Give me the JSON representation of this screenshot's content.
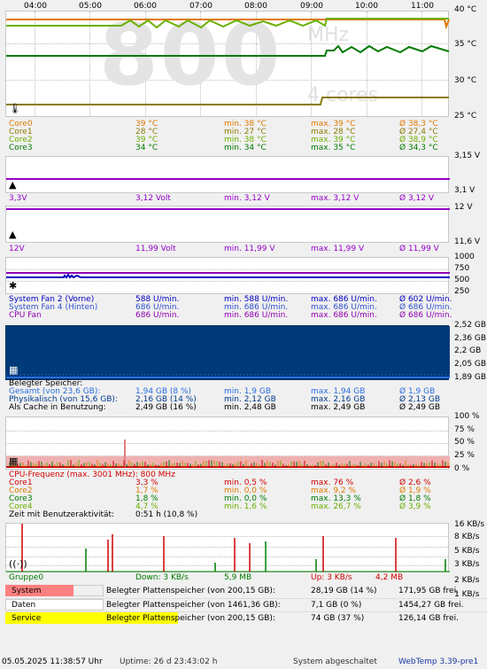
{
  "time_axis": [
    "04:00",
    "05:00",
    "06:00",
    "07:00",
    "08:00",
    "09:00",
    "10:00",
    "11:00"
  ],
  "temp": {
    "y_labels": [
      "40 °C",
      "35 °C",
      "30 °C",
      "25 °C"
    ],
    "watermark_value": "800",
    "watermark_unit": "MHz",
    "watermark_cores": "4 cores",
    "rows": [
      {
        "name": "Core0",
        "cur": "39 °C",
        "min": "min. 38 °C",
        "max": "max. 39 °C",
        "avg": "Ø 38,3 °C",
        "color": "#e07800"
      },
      {
        "name": "Core1",
        "cur": "28 °C",
        "min": "min. 27 °C",
        "max": "max. 28 °C",
        "avg": "Ø 27,4 °C",
        "color": "#8b7a00"
      },
      {
        "name": "Core2",
        "cur": "39 °C",
        "min": "min. 38 °C",
        "max": "max. 39 °C",
        "avg": "Ø 38,9 °C",
        "color": "#6ab000"
      },
      {
        "name": "Core3",
        "cur": "34 °C",
        "min": "min. 34 °C",
        "max": "max. 35 °C",
        "avg": "Ø 34,3 °C",
        "color": "#007a00"
      }
    ]
  },
  "v33": {
    "y_labels": [
      "3,15 V",
      "3,1 V"
    ],
    "row": {
      "name": "3,3V",
      "cur": "3,12 Volt",
      "min": "min. 3,12 V",
      "max": "max. 3,12 V",
      "avg": "Ø 3,12 V",
      "color": "#9400c8"
    }
  },
  "v12": {
    "y_labels": [
      "12 V",
      "11,6 V"
    ],
    "row": {
      "name": "12V",
      "cur": "11,99 Volt",
      "min": "min. 11,99 V",
      "max": "max. 11,99 V",
      "avg": "Ø 11,99 V",
      "color": "#9400c8"
    }
  },
  "fans": {
    "y_labels": [
      "1000",
      "750",
      "500",
      "250"
    ],
    "rows": [
      {
        "name": "System Fan 2 (Vorne)",
        "cur": "588 U/min.",
        "min": "min. 588 U/min.",
        "max": "max. 686 U/min.",
        "avg": "Ø 602 U/min.",
        "color": "#0000c0"
      },
      {
        "name": "System Fan 4 (Hinten)",
        "cur": "686 U/min.",
        "min": "min. 686 U/min.",
        "max": "max. 686 U/min.",
        "avg": "Ø 686 U/min.",
        "color": "#3050d0"
      },
      {
        "name": "CPU Fan",
        "cur": "686 U/min.",
        "min": "min. 686 U/min.",
        "max": "max. 686 U/min.",
        "avg": "Ø 686 U/min.",
        "color": "#9000b0"
      }
    ]
  },
  "mem": {
    "y_labels": [
      "2,52 GB",
      "2,36 GB",
      "2,2 GB",
      "2,05 GB",
      "1,89 GB"
    ],
    "title": "Belegter Speicher:",
    "rows": [
      {
        "name": "Gesamt (von 23,6 GB):",
        "cur": "1,94 GB (8 %)",
        "min": "min. 1,9 GB",
        "max": "max. 1,94 GB",
        "avg": "Ø 1,9 GB",
        "color": "#2a6ee0"
      },
      {
        "name": "Physikalisch (von 15,6 GB):",
        "cur": "2,16 GB (14 %)",
        "min": "min. 2,12 GB",
        "max": "max. 2,16 GB",
        "avg": "Ø 2,13 GB",
        "color": "#003a8c"
      },
      {
        "name": "Als Cache in Benutzung:",
        "cur": "2,49 GB (16 %)",
        "min": "min. 2,48 GB",
        "max": "max. 2,49 GB",
        "avg": "Ø 2,49 GB",
        "color": "#000000"
      }
    ]
  },
  "cpu": {
    "y_labels": [
      "100 %",
      "75 %",
      "50 %",
      "25 %",
      "0 %"
    ],
    "title": "CPU-Frequenz (max. 3001 MHz): 800 MHz",
    "title_color": "#d00000",
    "rows": [
      {
        "name": "Core1",
        "cur": "3,3 %",
        "min": "min. 0,5 %",
        "max": "max. 76 %",
        "avg": "Ø 2,6 %",
        "color": "#d00000"
      },
      {
        "name": "Core2",
        "cur": "1,7 %",
        "min": "min. 0,0 %",
        "max": "max. 9,2 %",
        "avg": "Ø 1,9 %",
        "color": "#e07800"
      },
      {
        "name": "Core3",
        "cur": "1,8 %",
        "min": "min. 0,0 %",
        "max": "max. 13,3 %",
        "avg": "Ø 1,8 %",
        "color": "#007a00"
      },
      {
        "name": "Core4",
        "cur": "4,7 %",
        "min": "min. 1,6 %",
        "max": "max. 26,7 %",
        "avg": "Ø 3,9 %",
        "color": "#6ab000"
      }
    ],
    "activity_label": "Zeit mit Benutzeraktivität:",
    "activity_value": "0:51 h (10,8 %)"
  },
  "net": {
    "y_labels": [
      "16 KB/s",
      "8 KB/s",
      "5 KB/s",
      "3 KB/s",
      "2 KB/s",
      "1 KB/s"
    ],
    "group": "Gruppe0",
    "down": "Down: 3 KB/s",
    "down_total": "5,9 MB",
    "up": "Up: 3 KB/s",
    "up_total": "4,2 MB"
  },
  "drives": [
    {
      "name": "System",
      "label": "Belegter Plattenspeicher (von 200,15 GB):",
      "used": "28,19 GB (14 %)",
      "free": "171,95 GB frei.",
      "fill": 0.14,
      "color": "#ff8080"
    },
    {
      "name": "Daten",
      "label": "Belegter Plattenspeicher (von 1461,36 GB):",
      "used": "7,1 GB (0 %)",
      "free": "1454,27 GB frei.",
      "fill": 0.005,
      "color": "#ffffff"
    },
    {
      "name": "Service",
      "label": "Belegter Plattenspeicher (von 200,15 GB):",
      "used": "74 GB (37 %)",
      "free": "126,14 GB frei.",
      "fill": 0.37,
      "color": "#ffff00"
    }
  ],
  "footer": {
    "datetime": "05.05.2025 11:38:57 Uhr",
    "uptime": "Uptime: 26 d 23:43:02 h",
    "status": "System abgeschaltet",
    "app": "WebTemp 3.39-pre1"
  }
}
